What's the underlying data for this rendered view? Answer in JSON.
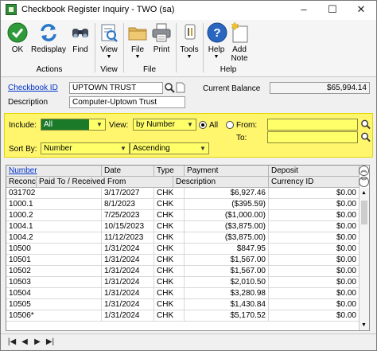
{
  "window": {
    "title": "Checkbook Register Inquiry  -  TWO (sa)",
    "minimize": "–",
    "maximize": "☐",
    "close": "✕"
  },
  "ribbon": {
    "buttons": [
      {
        "label": "OK",
        "icon": "check-icon"
      },
      {
        "label": "Redisplay",
        "icon": "refresh-icon"
      },
      {
        "label": "Find",
        "icon": "binoculars-icon"
      },
      {
        "label": "View",
        "icon": "view-icon"
      },
      {
        "label": "File",
        "icon": "folder-icon"
      },
      {
        "label": "Print",
        "icon": "printer-icon"
      },
      {
        "label": "Tools",
        "icon": "tools-icon"
      },
      {
        "label": "Help",
        "icon": "help-icon"
      },
      {
        "label": "Add\nNote",
        "icon": "note-icon"
      }
    ],
    "groups": [
      "Actions",
      "View",
      "File",
      "Help"
    ]
  },
  "header": {
    "checkbook_label": "Checkbook ID",
    "checkbook_id": "UPTOWN TRUST",
    "description_label": "Description",
    "description": "Computer-Uptown Trust",
    "balance_label": "Current Balance",
    "balance": "$65,994.14"
  },
  "filters": {
    "include_label": "Include:",
    "include_value": "All",
    "view_label": "View:",
    "view_value": "by Number",
    "all_label": "All",
    "from_label": "From:",
    "to_label": "To:",
    "sortby_label": "Sort By:",
    "sortby_value": "Number",
    "order_value": "Ascending"
  },
  "grid": {
    "columns_top": [
      "Number",
      "Date",
      "Type",
      "Payment",
      "Deposit"
    ],
    "columns_bottom": [
      "Reconciled",
      "Paid To / Received From",
      "Description",
      "Currency ID"
    ],
    "rows": [
      {
        "number": "031702",
        "date": "3/17/2027",
        "type": "CHK",
        "payment": "$6,927.46",
        "deposit": "$0.00"
      },
      {
        "number": "1000.1",
        "date": "8/1/2023",
        "type": "CHK",
        "payment": "($395.59)",
        "deposit": "$0.00"
      },
      {
        "number": "1000.2",
        "date": "7/25/2023",
        "type": "CHK",
        "payment": "($1,000.00)",
        "deposit": "$0.00"
      },
      {
        "number": "1004.1",
        "date": "10/15/2023",
        "type": "CHK",
        "payment": "($3,875.00)",
        "deposit": "$0.00"
      },
      {
        "number": "1004.2",
        "date": "11/12/2023",
        "type": "CHK",
        "payment": "($3,875.00)",
        "deposit": "$0.00"
      },
      {
        "number": "10500",
        "date": "1/31/2024",
        "type": "CHK",
        "payment": "$847.95",
        "deposit": "$0.00"
      },
      {
        "number": "10501",
        "date": "1/31/2024",
        "type": "CHK",
        "payment": "$1,567.00",
        "deposit": "$0.00"
      },
      {
        "number": "10502",
        "date": "1/31/2024",
        "type": "CHK",
        "payment": "$1,567.00",
        "deposit": "$0.00"
      },
      {
        "number": "10503",
        "date": "1/31/2024",
        "type": "CHK",
        "payment": "$2,010.50",
        "deposit": "$0.00"
      },
      {
        "number": "10504",
        "date": "1/31/2024",
        "type": "CHK",
        "payment": "$3,280.98",
        "deposit": "$0.00"
      },
      {
        "number": "10505",
        "date": "1/31/2024",
        "type": "CHK",
        "payment": "$1,430.84",
        "deposit": "$0.00"
      },
      {
        "number": "10506*",
        "date": "1/31/2024",
        "type": "CHK",
        "payment": "$5,170.52",
        "deposit": "$0.00"
      }
    ]
  },
  "nav": [
    "|◀",
    "◀",
    "▶",
    "▶|"
  ],
  "colors": {
    "highlight": "#fff66e",
    "include_selected": "#1b7a2a",
    "link": "#0033cc"
  }
}
